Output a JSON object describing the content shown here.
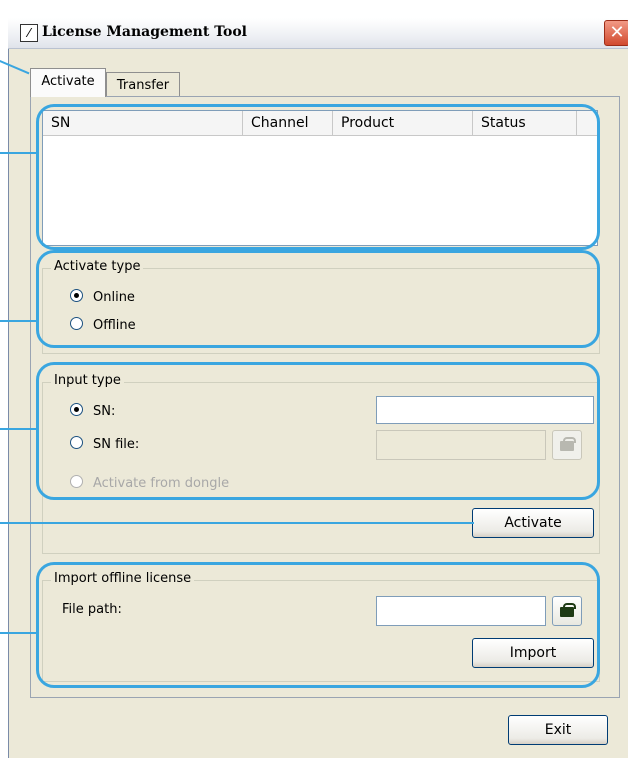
{
  "window": {
    "title": "License Management Tool",
    "close_glyph": "✕"
  },
  "tabs": [
    {
      "label": "Activate"
    },
    {
      "label": "Transfer"
    }
  ],
  "list": {
    "columns": [
      "SN",
      "Channel",
      "Product",
      "Status"
    ],
    "rows": []
  },
  "activate_type": {
    "title": "Activate type",
    "options": [
      {
        "label": "Online",
        "selected": true
      },
      {
        "label": "Offline",
        "selected": false
      }
    ]
  },
  "input_type": {
    "title": "Input type",
    "sn_label": "SN:",
    "sn_value": "",
    "sn_file_label": "SN file:",
    "sn_file_value": "",
    "dongle_label": "Activate from dongle",
    "selected": "SN"
  },
  "activate_button": "Activate",
  "import_offline": {
    "title": "Import offline license",
    "file_path_label": "File path:",
    "file_path_value": "",
    "import_button": "Import"
  },
  "exit_button": "Exit",
  "colors": {
    "highlight": "#3aa6e0",
    "window_bg": "#ece9d8",
    "close": "#d14a2e"
  },
  "icons": [
    "app-icon",
    "close-icon",
    "folder-open-icon"
  ]
}
